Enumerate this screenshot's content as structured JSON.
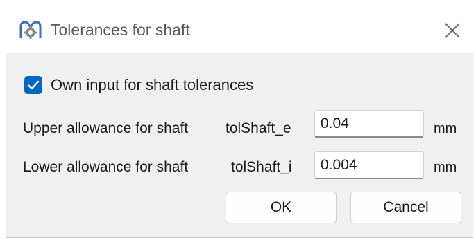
{
  "window": {
    "title": "Tolerances for shaft",
    "icon": "gear-app-icon",
    "close_icon": "close-icon"
  },
  "checkbox": {
    "label": "Own input for shaft tolerances",
    "checked": true
  },
  "rows": [
    {
      "label": "Upper allowance for shaft",
      "variable": "tolShaft_e",
      "value": "0.04",
      "unit": "mm"
    },
    {
      "label": "Lower allowance for shaft",
      "variable": "tolShaft_i",
      "value": "0.004",
      "unit": "mm"
    }
  ],
  "buttons": {
    "ok": "OK",
    "cancel": "Cancel"
  },
  "colors": {
    "accent": "#0067c0",
    "dialog_bg": "#f0f0f0",
    "titlebar_bg": "#ffffff"
  }
}
